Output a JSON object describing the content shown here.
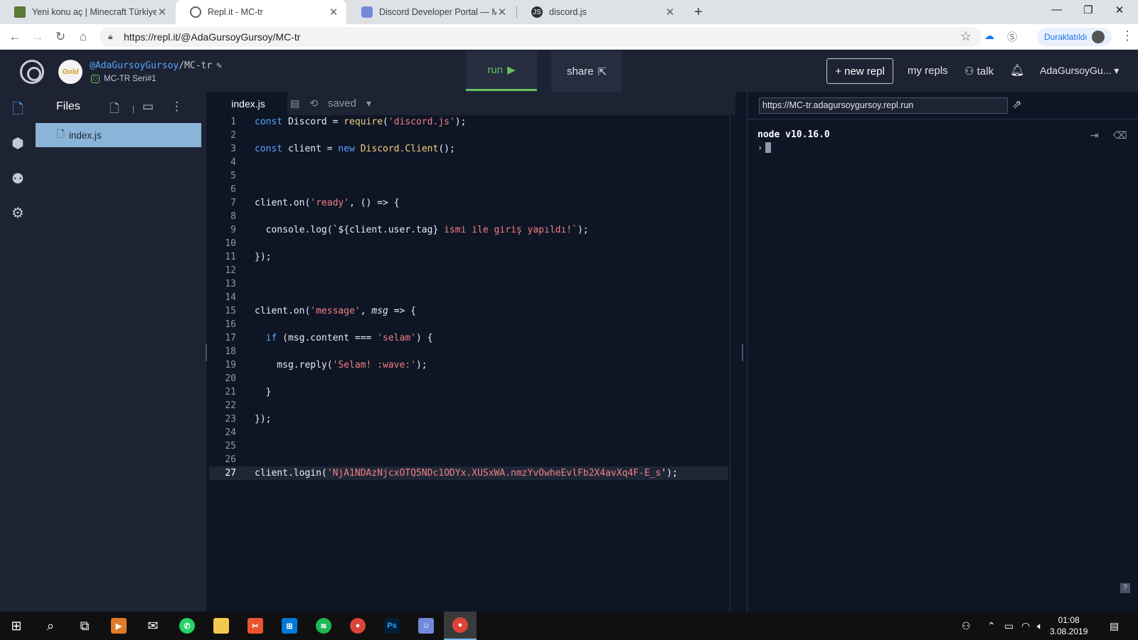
{
  "browser": {
    "tabs": [
      {
        "title": "Yeni konu aç | Minecraft Türkiye",
        "icon": "minecraft-icon"
      },
      {
        "title": "Repl.it - MC-tr",
        "icon": "replit-icon"
      },
      {
        "title": "Discord Developer Portal — My /",
        "icon": "discord-icon"
      },
      {
        "title": "discord.js",
        "icon": "discordjs-icon"
      }
    ],
    "url": "https://repl.it/@AdaGursoyGursoy/MC-tr",
    "profile_status": "Duraklatıldı"
  },
  "repl": {
    "owner": "@AdaGursoyGursoy",
    "separator": "/",
    "name": "MC-tr",
    "avatar_text": "Gold",
    "subtitle": "MC-TR Seri#1",
    "run_label": "run",
    "share_label": "share",
    "new_repl_label": "+ new repl",
    "my_repls_label": "my repls",
    "talk_label": "talk",
    "username": "AdaGursoyGu...",
    "files_header": "Files",
    "file_name": "index.js",
    "editor_tab": "index.js",
    "save_status": "saved"
  },
  "code_lines": [
    "1",
    "2",
    "3",
    "4",
    "5",
    "6",
    "7",
    "8",
    "9",
    "10",
    "11",
    "12",
    "13",
    "14",
    "15",
    "16",
    "17",
    "18",
    "19",
    "20",
    "21",
    "22",
    "23",
    "24",
    "25",
    "26",
    "27"
  ],
  "code": {
    "l1": {
      "a": "const",
      "b": " Discord = ",
      "c": "require",
      "d": "(",
      "e": "'discord.js'",
      "f": ");"
    },
    "l3": {
      "a": "const",
      "b": " client = ",
      "c": "new",
      "d": " Discord.Client",
      "e": "();"
    },
    "l7": {
      "a": "client.on(",
      "b": "'ready'",
      "c": ", () => {"
    },
    "l9": {
      "a": "  console.log(`${client.user.tag} ",
      "b": "ismi ile giriş yapıldı!`",
      "c": ");"
    },
    "l11": "});",
    "l15": {
      "a": "client.on(",
      "b": "'message'",
      "c": ", ",
      "d": "msg",
      "e": " => {"
    },
    "l17": {
      "a": "  ",
      "b": "if",
      "c": " (msg.content === ",
      "d": "'selam'",
      "e": ") {"
    },
    "l19": {
      "a": "    msg.reply(",
      "b": "'Selam! :wave:'",
      "c": ");"
    },
    "l21": "  }",
    "l23": "});",
    "l27": {
      "a": "client.login(",
      "b": "'NjA1NDAzNjcxOTQ5NDc1ODYx.XUSxWA.nmzYvOwheEvlFb2X4avXq4F-E_s",
      "c": "');"
    }
  },
  "console": {
    "url": "https://MC-tr.adagursoygursoy.repl.run",
    "output": "node v10.16.0",
    "prompt": "›",
    "help": "?"
  },
  "taskbar": {
    "time": "01:08",
    "date": "3.08.2019"
  },
  "colors": {
    "bg": "#0e1525",
    "panel": "#1d2333",
    "run_green": "#64c25e",
    "keyword": "#57a5ff",
    "string": "#f08080"
  }
}
